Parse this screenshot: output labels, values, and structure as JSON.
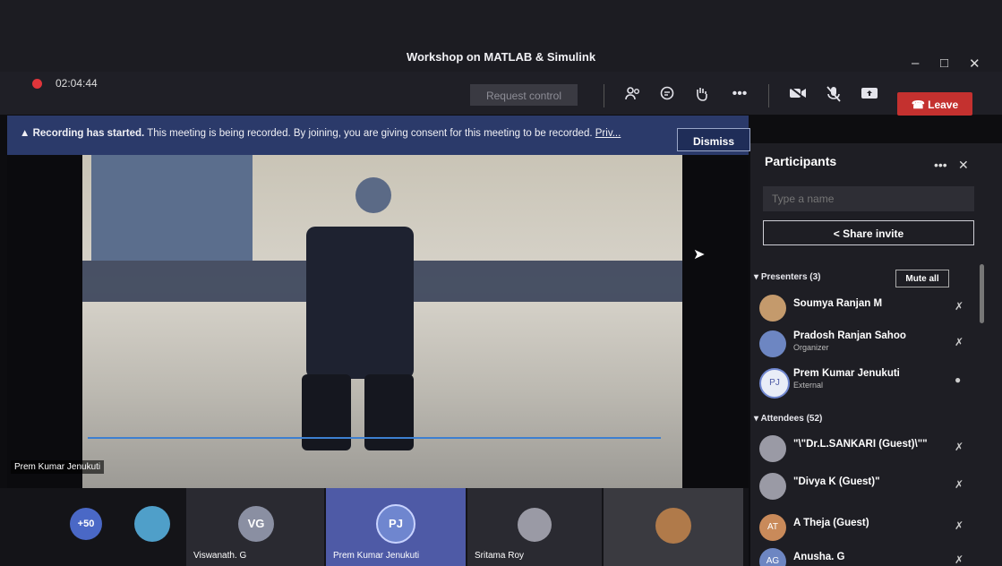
{
  "window": {
    "title": "Workshop on MATLAB & Simulink",
    "minimize": "–",
    "maximize": "□",
    "close": "✕"
  },
  "toolbar": {
    "timer": "02:04:44",
    "request_control": "Request control",
    "more": "•••",
    "leave": "Leave"
  },
  "banner": {
    "bold": "Recording has started.",
    "text": "This meeting is being recorded. By joining, you are giving consent for this meeting to be recorded.",
    "link": "Priv...",
    "dismiss": "Dismiss"
  },
  "stage": {
    "speaker_name": "Prem Kumar Jenukuti"
  },
  "strip": {
    "overflow": "+50",
    "tiles": [
      {
        "initials": "VG",
        "name": "Viswanath. G"
      },
      {
        "initials": "PJ",
        "name": "Prem Kumar Jenukuti"
      },
      {
        "initials": "",
        "name": "Sritama Roy"
      }
    ]
  },
  "panel": {
    "title": "Participants",
    "more": "•••",
    "close": "✕",
    "search_placeholder": "Type a name",
    "share_invite": "Share invite",
    "presenters_label": "Presenters (3)",
    "mute_all": "Mute all",
    "attendees_label": "Attendees (52)",
    "presenters": [
      {
        "name": "Soumya Ranjan M",
        "role": "",
        "initials": ""
      },
      {
        "name": "Pradosh Ranjan Sahoo",
        "role": "Organizer",
        "initials": ""
      },
      {
        "name": "Prem Kumar Jenukuti",
        "role": "External",
        "initials": "PJ"
      }
    ],
    "attendees": [
      {
        "name": "\"\\\"Dr.L.SANKARI (Guest)\\\"\"",
        "initials": ""
      },
      {
        "name": "\"Divya K (Guest)\"",
        "initials": ""
      },
      {
        "name": "A Theja (Guest)",
        "initials": "AT"
      },
      {
        "name": "Anusha. G",
        "initials": "AG"
      }
    ]
  },
  "colors": {
    "leave": "#c4312f",
    "banner": "#2b3a6a",
    "accent": "#3d7fd0"
  }
}
